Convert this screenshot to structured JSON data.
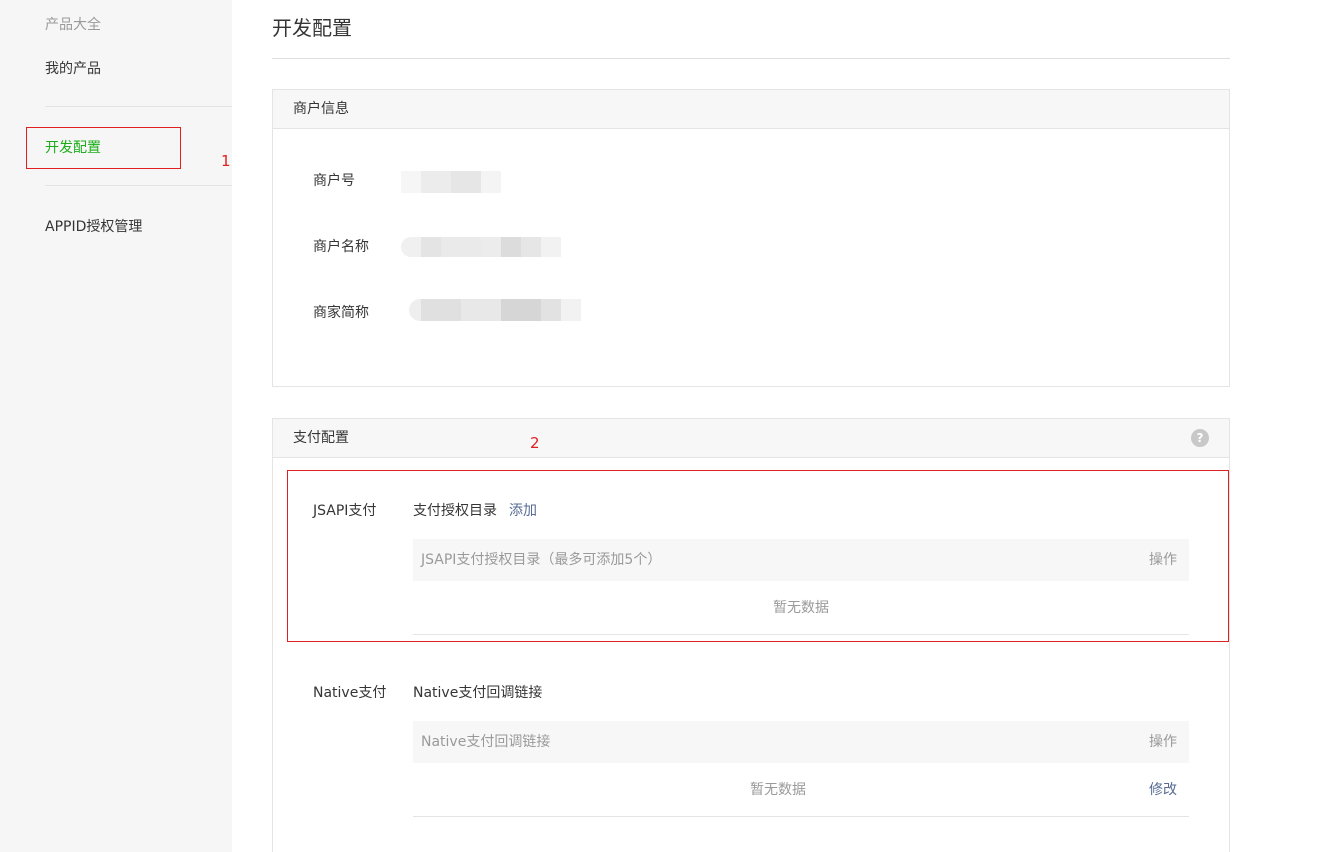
{
  "sidebar": {
    "category": "产品大全",
    "my_products": "我的产品",
    "dev_config": "开发配置",
    "appid_auth": "APPID授权管理"
  },
  "annotations": [
    "1",
    "2"
  ],
  "page": {
    "title": "开发配置"
  },
  "merchant_info": {
    "title": "商户信息",
    "fields": [
      {
        "label": "商户号"
      },
      {
        "label": "商户名称"
      },
      {
        "label": "商家简称"
      }
    ]
  },
  "payment_config": {
    "title": "支付配置",
    "help_icon": "?",
    "jsapi": {
      "label": "JSAPI支付",
      "section_title": "支付授权目录",
      "add_label": "添加",
      "table_header": "JSAPI支付授权目录（最多可添加5个）",
      "action_header": "操作",
      "empty_text": "暂无数据"
    },
    "native": {
      "label": "Native支付",
      "section_title": "Native支付回调链接",
      "table_header": "Native支付回调链接",
      "action_header": "操作",
      "empty_text": "暂无数据",
      "modify_label": "修改"
    }
  },
  "colors": {
    "accent_green": "#1aad19",
    "link_blue": "#576b95",
    "annotation_red": "#e02020"
  }
}
